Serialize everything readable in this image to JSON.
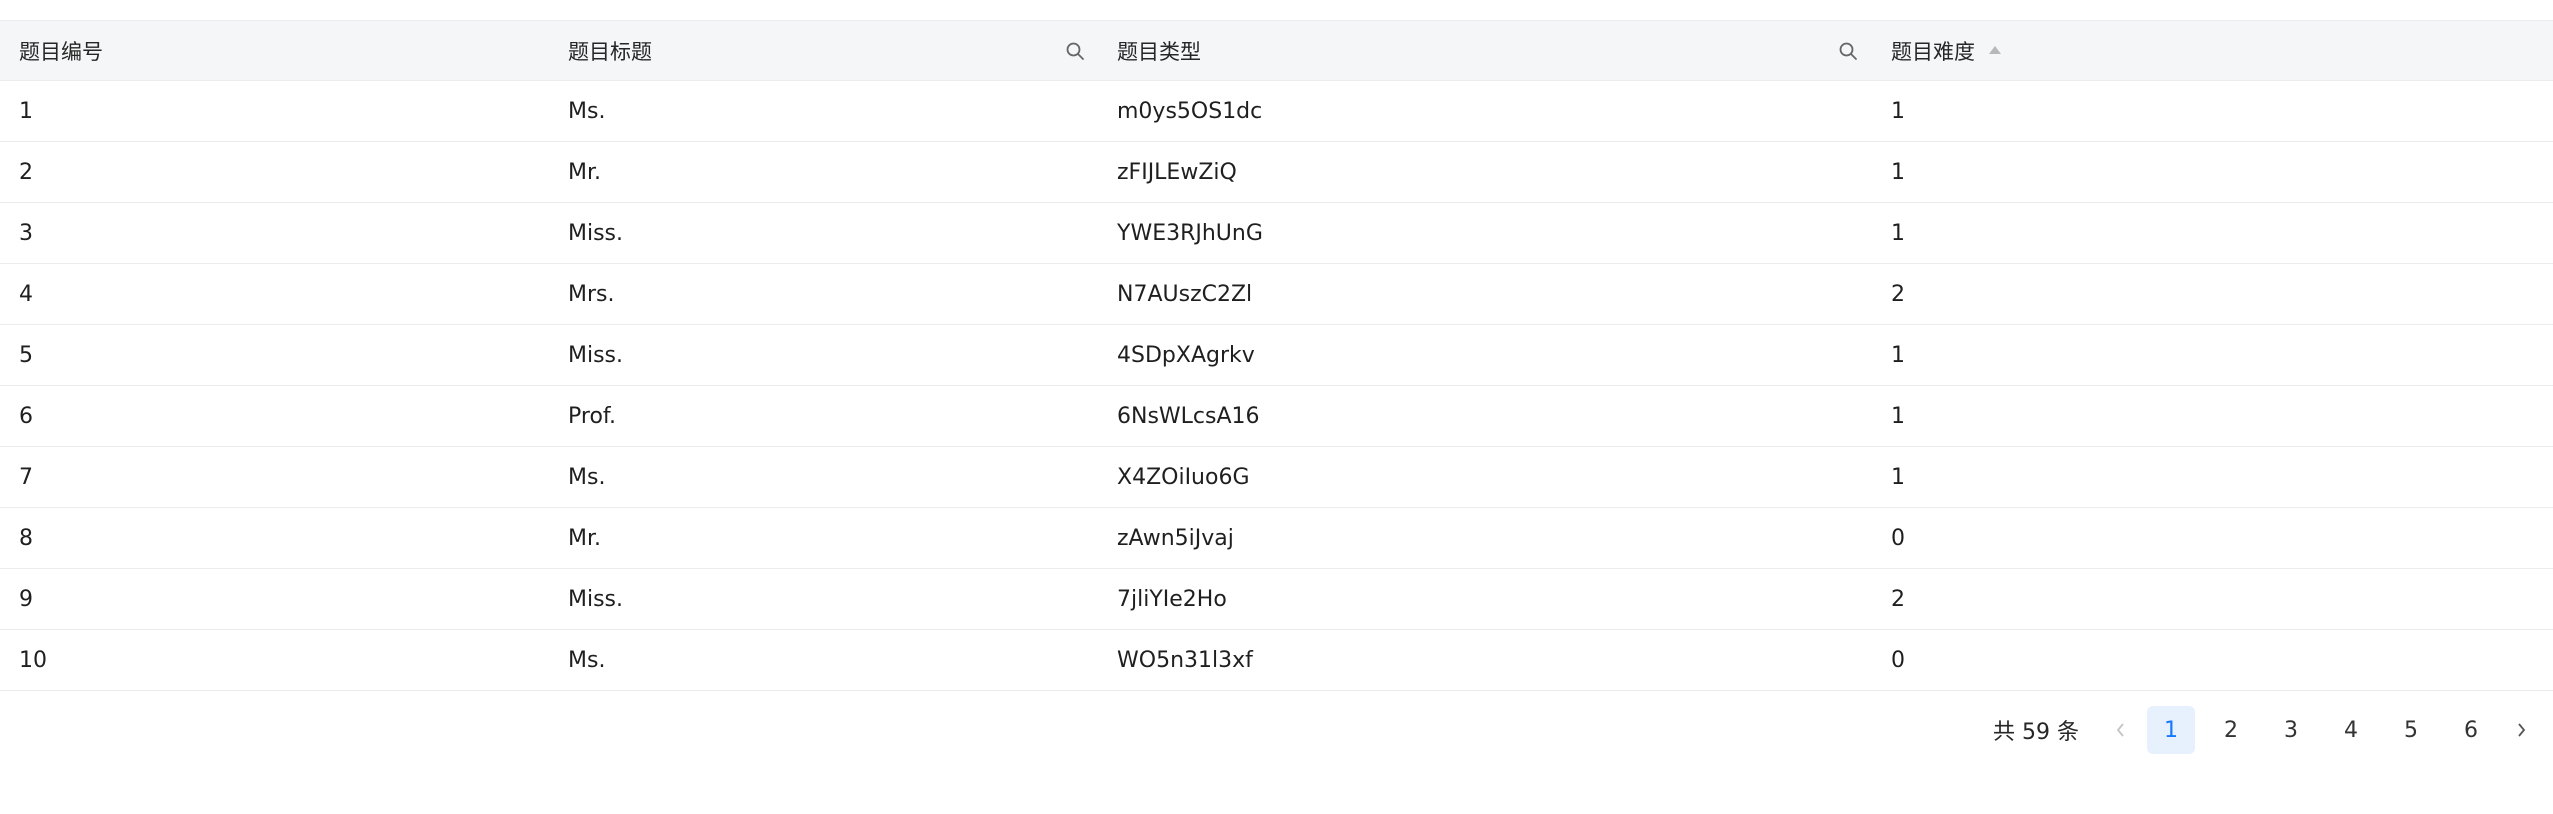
{
  "table": {
    "headers": {
      "id": "题目编号",
      "title": "题目标题",
      "type": "题目类型",
      "difficulty": "题目难度"
    },
    "rows": [
      {
        "id": "1",
        "title": "Ms.",
        "type": "m0ys5OS1dc",
        "difficulty": "1"
      },
      {
        "id": "2",
        "title": "Mr.",
        "type": "zFIJLEwZiQ",
        "difficulty": "1"
      },
      {
        "id": "3",
        "title": "Miss.",
        "type": "YWE3RJhUnG",
        "difficulty": "1"
      },
      {
        "id": "4",
        "title": "Mrs.",
        "type": "N7AUszC2Zl",
        "difficulty": "2"
      },
      {
        "id": "5",
        "title": "Miss.",
        "type": "4SDpXAgrkv",
        "difficulty": "1"
      },
      {
        "id": "6",
        "title": "Prof.",
        "type": "6NsWLcsA16",
        "difficulty": "1"
      },
      {
        "id": "7",
        "title": "Ms.",
        "type": "X4ZOiIuo6G",
        "difficulty": "1"
      },
      {
        "id": "8",
        "title": "Mr.",
        "type": "zAwn5iJvaj",
        "difficulty": "0"
      },
      {
        "id": "9",
        "title": "Miss.",
        "type": "7jliYIe2Ho",
        "difficulty": "2"
      },
      {
        "id": "10",
        "title": "Ms.",
        "type": "WO5n31l3xf",
        "difficulty": "0"
      }
    ]
  },
  "pagination": {
    "total": "共 59 条",
    "pages": [
      "1",
      "2",
      "3",
      "4",
      "5",
      "6"
    ],
    "current": "1"
  },
  "icons": {
    "search": "search-icon",
    "sort": "caret-up-icon",
    "prev": "chevron-left-icon",
    "next": "chevron-right-icon"
  },
  "colors": {
    "header_bg": "#f5f6f7",
    "active_page_bg": "#e6f1fd",
    "active_page_text": "#1677ff"
  }
}
